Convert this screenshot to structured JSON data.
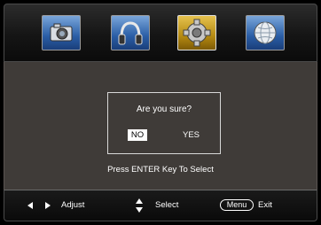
{
  "tabs": [
    {
      "name": "picture",
      "icon": "camera-icon",
      "selected": false
    },
    {
      "name": "audio",
      "icon": "headphones-icon",
      "selected": false
    },
    {
      "name": "setup",
      "icon": "gear-icon",
      "selected": true
    },
    {
      "name": "network",
      "icon": "globe-icon",
      "selected": false
    }
  ],
  "dialog": {
    "question": "Are you sure?",
    "no_label": "NO",
    "yes_label": "YES",
    "selected": "NO"
  },
  "hint": "Press ENTER Key To Select",
  "footer": {
    "adjust_icon": "left-right-arrows-icon",
    "adjust_label": "Adjust",
    "select_icon": "up-down-arrows-icon",
    "select_label": "Select",
    "menu_key": "Menu",
    "exit_label": "Exit"
  },
  "colors": {
    "panel_background": "#3f3b38",
    "tab_blue": "#2a5ea6",
    "tab_selected": "#b58a12",
    "selected_button": "#ffffff",
    "text": "#ffffff"
  }
}
